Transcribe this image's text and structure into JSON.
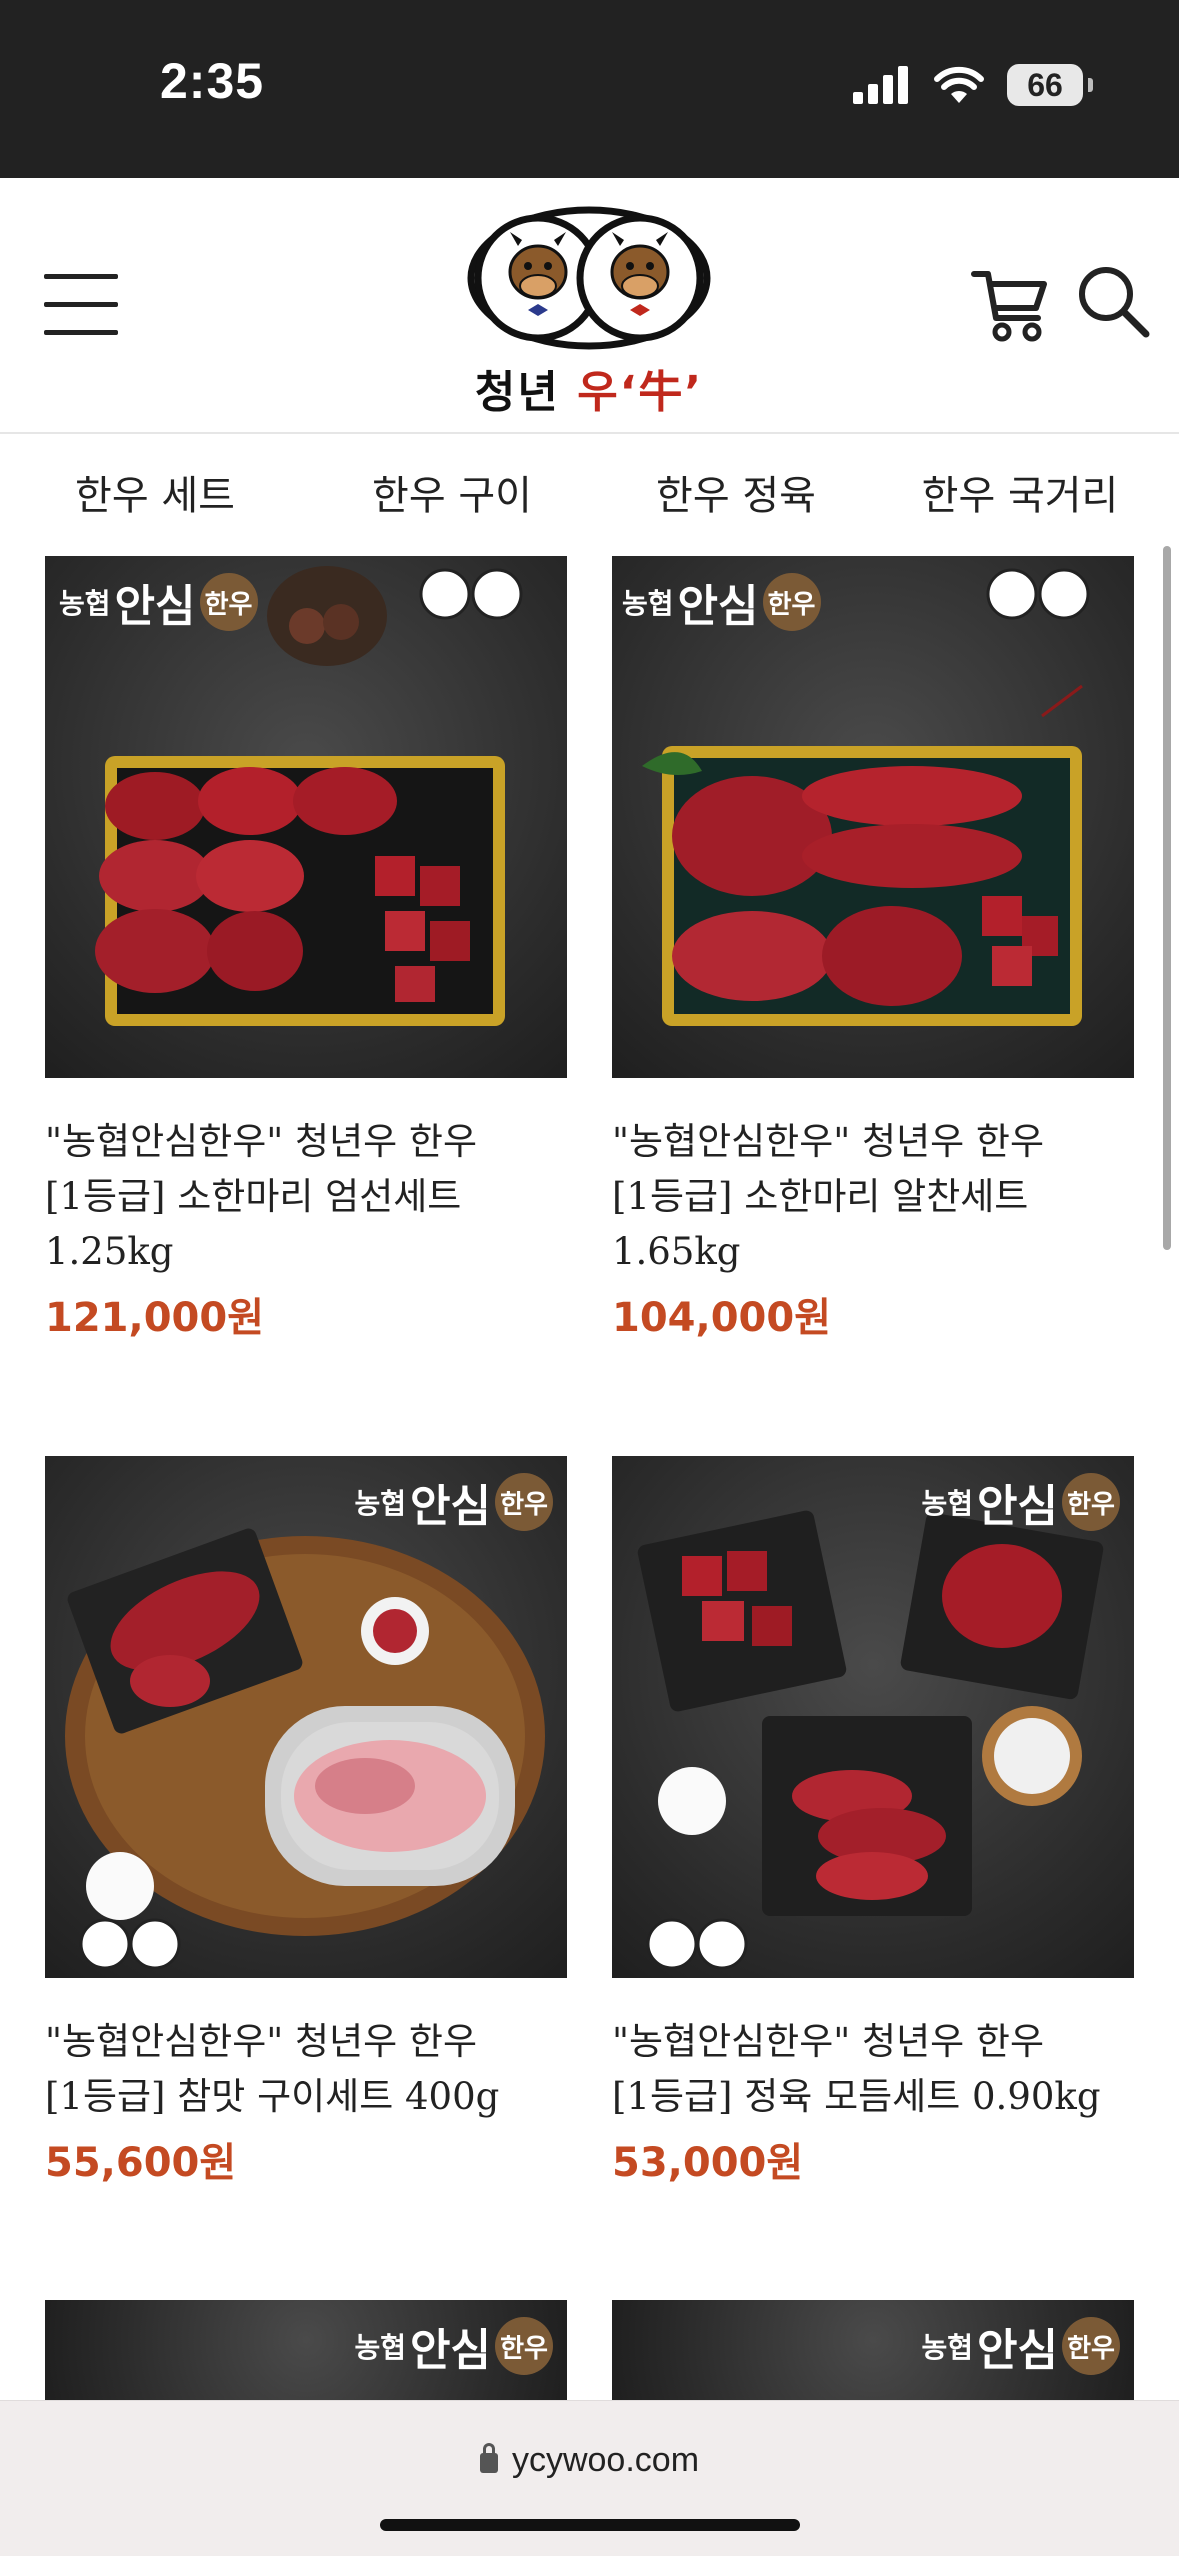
{
  "status_bar": {
    "time": "2:35",
    "battery": "66"
  },
  "header": {
    "logo_text_1": "청년",
    "logo_text_2": "우‘牛’",
    "icons": {
      "menu": "hamburger-menu-icon",
      "cart": "cart-icon",
      "search": "search-icon"
    }
  },
  "categories": [
    "한우 세트",
    "한우 구이",
    "한우 정육",
    "한우 국거리"
  ],
  "badge": {
    "part1": "농협",
    "part2": "안심",
    "part3": "한우"
  },
  "products": [
    {
      "title_line1": "\"농협안심한우\" 청년우 한우",
      "title_line2": "[1등급] 소한마리 엄선세트",
      "title_line3": "1.25kg",
      "price": "121,000원"
    },
    {
      "title_line1": "\"농협안심한우\" 청년우 한우",
      "title_line2": "[1등급] 소한마리 알찬세트",
      "title_line3": "1.65kg",
      "price": "104,000원"
    },
    {
      "title_line1": "\"농협안심한우\" 청년우 한우",
      "title_line2": "[1등급] 참맛 구이세트 400g",
      "title_line3": "",
      "price": "55,600원"
    },
    {
      "title_line1": "\"농협안심한우\" 청년우 한우",
      "title_line2": "[1등급] 정육 모듬세트 0.90kg",
      "title_line3": "",
      "price": "53,000원"
    }
  ],
  "browser": {
    "url": "ycywoo.com"
  },
  "colors": {
    "price": "#c44a22",
    "logo_red": "#c0281c",
    "status_bg": "#222222"
  }
}
